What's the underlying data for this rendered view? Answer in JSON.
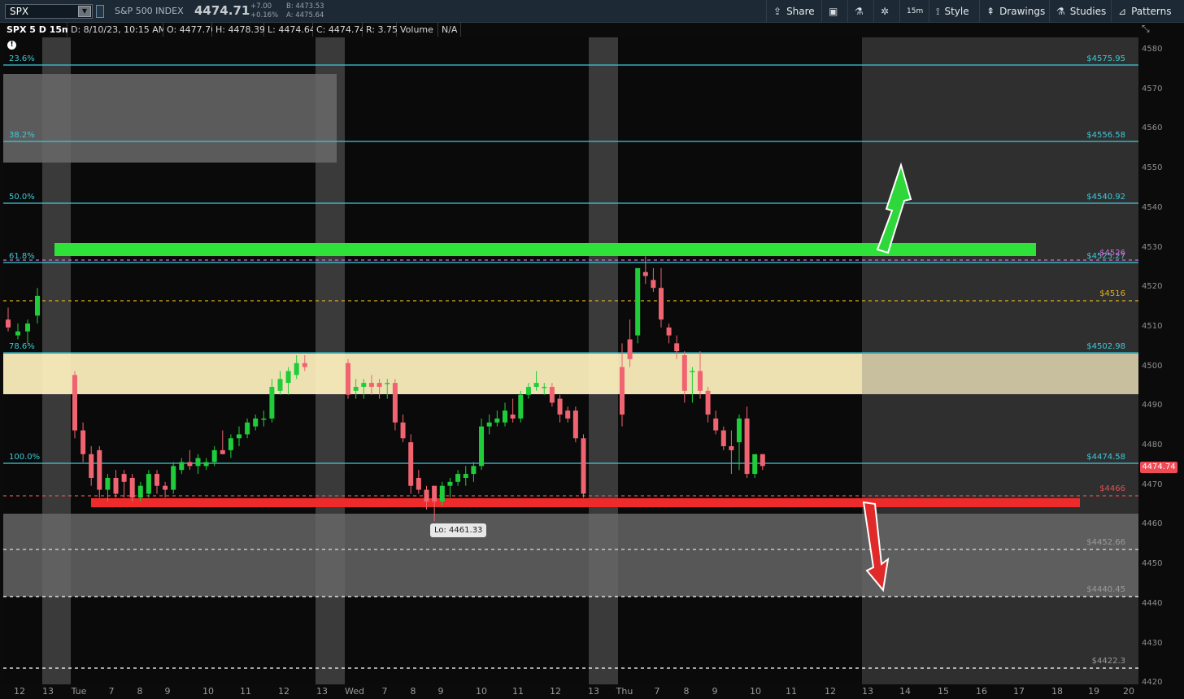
{
  "toolbar": {
    "symbol": "SPX",
    "name": "S&P 500 INDEX",
    "last": "4474.71",
    "change": "+7.00",
    "change_pct": "+0.16%",
    "bid": "B: 4473.53",
    "ask": "A: 4475.64",
    "buttons": {
      "share": "Share",
      "interval": "15m",
      "style": "Style",
      "drawings": "Drawings",
      "studies": "Studies",
      "patterns": "Patterns"
    }
  },
  "info": {
    "title": "SPX 5 D 15m",
    "date": "D: 8/10/23, 10:15 AM",
    "open": "O: 4477.76",
    "high": "H: 4478.39",
    "low": "L: 4474.64",
    "close": "C: 4474.74",
    "range": "R: 3.75",
    "volume": "Volume",
    "volume_value": "N/A"
  },
  "axis": {
    "price_ticks": [
      "4580",
      "4570",
      "4560",
      "4550",
      "4540",
      "4530",
      "4520",
      "4510",
      "4500",
      "4490",
      "4480",
      "4470",
      "4460",
      "4450",
      "4440",
      "4430",
      "4420"
    ],
    "time_ticks": [
      "12",
      "13",
      "Tue",
      "7",
      "8",
      "9",
      "10",
      "11",
      "12",
      "13",
      "Wed",
      "7",
      "8",
      "9",
      "10",
      "11",
      "12",
      "13",
      "Thu",
      "7",
      "8",
      "9",
      "10",
      "11",
      "12",
      "13",
      "14",
      "15",
      "16",
      "17",
      "18",
      "19",
      "20"
    ],
    "current_price_tag": "4474.74"
  },
  "levels": {
    "fib": [
      {
        "pct": "23.6%",
        "price_label": "$4575.95"
      },
      {
        "pct": "38.2%",
        "price_label": "$4556.58"
      },
      {
        "pct": "50.0%",
        "price_label": "$4540.92"
      },
      {
        "pct": "61.8%",
        "price_label": "$4525.27"
      },
      {
        "pct": "78.6%",
        "price_label": "$4502.98"
      },
      {
        "pct": "100.0%",
        "price_label": "$4474.58"
      }
    ],
    "h_lines": [
      {
        "label": "$4526"
      },
      {
        "label": "$4516"
      },
      {
        "label": "$4466"
      },
      {
        "label": "$4452.66"
      },
      {
        "label": "$4440.45"
      },
      {
        "label": "$4422.3"
      }
    ],
    "low_callout": "Lo: 4461.33"
  },
  "colors": {
    "bull": "#1fcd3a",
    "bear": "#ef6470",
    "fib": "#3ec9d8",
    "green_band": "#2fe23a",
    "red_band": "#ee2a2a",
    "zone": "#fff2c0"
  },
  "chart_data": {
    "type": "candlestick",
    "title": "SPX 5 D 15m",
    "ylim": [
      4418,
      4584
    ],
    "candles": [
      {
        "o": 4512,
        "h": 4515,
        "l": 4509,
        "c": 4510
      },
      {
        "o": 4508,
        "h": 4511,
        "l": 4507,
        "c": 4509
      },
      {
        "o": 4509,
        "h": 4512,
        "l": 4506,
        "c": 4511
      },
      {
        "o": 4513,
        "h": 4520,
        "l": 4511,
        "c": 4518
      },
      {
        "o": 4498,
        "h": 4499,
        "l": 4482,
        "c": 4484
      },
      {
        "o": 4484,
        "h": 4486,
        "l": 4476,
        "c": 4478
      },
      {
        "o": 4478,
        "h": 4480,
        "l": 4470,
        "c": 4472
      },
      {
        "o": 4479,
        "h": 4480,
        "l": 4467,
        "c": 4469
      },
      {
        "o": 4469,
        "h": 4473,
        "l": 4466,
        "c": 4472
      },
      {
        "o": 4472,
        "h": 4474,
        "l": 4467,
        "c": 4468
      },
      {
        "o": 4473,
        "h": 4474,
        "l": 4467,
        "c": 4471
      },
      {
        "o": 4472,
        "h": 4473,
        "l": 4466,
        "c": 4467
      },
      {
        "o": 4467,
        "h": 4471,
        "l": 4466,
        "c": 4470
      },
      {
        "o": 4468,
        "h": 4474,
        "l": 4467,
        "c": 4473
      },
      {
        "o": 4473,
        "h": 4474,
        "l": 4468,
        "c": 4470
      },
      {
        "o": 4470,
        "h": 4471,
        "l": 4467,
        "c": 4469
      },
      {
        "o": 4469,
        "h": 4476,
        "l": 4468,
        "c": 4475
      },
      {
        "o": 4474,
        "h": 4477,
        "l": 4473,
        "c": 4476
      },
      {
        "o": 4476,
        "h": 4479,
        "l": 4474,
        "c": 4475
      },
      {
        "o": 4475,
        "h": 4478,
        "l": 4473,
        "c": 4477
      },
      {
        "o": 4475,
        "h": 4477,
        "l": 4474,
        "c": 4476
      },
      {
        "o": 4476,
        "h": 4480,
        "l": 4475,
        "c": 4479
      },
      {
        "o": 4479,
        "h": 4484,
        "l": 4478,
        "c": 4478
      },
      {
        "o": 4479,
        "h": 4483,
        "l": 4477,
        "c": 4482
      },
      {
        "o": 4482,
        "h": 4485,
        "l": 4480,
        "c": 4483
      },
      {
        "o": 4483,
        "h": 4487,
        "l": 4482,
        "c": 4486
      },
      {
        "o": 4485,
        "h": 4488,
        "l": 4484,
        "c": 4487
      },
      {
        "o": 4487,
        "h": 4489,
        "l": 4485,
        "c": 4487
      },
      {
        "o": 4487,
        "h": 4497,
        "l": 4486,
        "c": 4495
      },
      {
        "o": 4494,
        "h": 4499,
        "l": 4493,
        "c": 4497
      },
      {
        "o": 4496,
        "h": 4500,
        "l": 4493,
        "c": 4499
      },
      {
        "o": 4498,
        "h": 4503,
        "l": 4497,
        "c": 4501
      },
      {
        "o": 4501,
        "h": 4503,
        "l": 4499,
        "c": 4500
      },
      {
        "o": 4501,
        "h": 4502,
        "l": 4492,
        "c": 4493
      },
      {
        "o": 4494,
        "h": 4497,
        "l": 4492,
        "c": 4495
      },
      {
        "o": 4495,
        "h": 4497,
        "l": 4492,
        "c": 4496
      },
      {
        "o": 4496,
        "h": 4498,
        "l": 4493,
        "c": 4495
      },
      {
        "o": 4496,
        "h": 4497,
        "l": 4492,
        "c": 4495
      },
      {
        "o": 4496,
        "h": 4497,
        "l": 4492,
        "c": 4496
      },
      {
        "o": 4496,
        "h": 4497,
        "l": 4484,
        "c": 4486
      },
      {
        "o": 4486,
        "h": 4488,
        "l": 4481,
        "c": 4482
      },
      {
        "o": 4481,
        "h": 4483,
        "l": 4468,
        "c": 4470
      },
      {
        "o": 4472,
        "h": 4474,
        "l": 4468,
        "c": 4469
      },
      {
        "o": 4469,
        "h": 4470,
        "l": 4464,
        "c": 4466
      },
      {
        "o": 4470,
        "h": 4470,
        "l": 4461,
        "c": 4466
      },
      {
        "o": 4466,
        "h": 4471,
        "l": 4465,
        "c": 4470
      },
      {
        "o": 4470,
        "h": 4472,
        "l": 4467,
        "c": 4471
      },
      {
        "o": 4471,
        "h": 4474,
        "l": 4470,
        "c": 4473
      },
      {
        "o": 4472,
        "h": 4475,
        "l": 4470,
        "c": 4473
      },
      {
        "o": 4473,
        "h": 4476,
        "l": 4471,
        "c": 4475
      },
      {
        "o": 4475,
        "h": 4487,
        "l": 4474,
        "c": 4485
      },
      {
        "o": 4485,
        "h": 4488,
        "l": 4483,
        "c": 4486
      },
      {
        "o": 4486,
        "h": 4489,
        "l": 4485,
        "c": 4487
      },
      {
        "o": 4486,
        "h": 4491,
        "l": 4485,
        "c": 4489
      },
      {
        "o": 4488,
        "h": 4492,
        "l": 4486,
        "c": 4487
      },
      {
        "o": 4487,
        "h": 4494,
        "l": 4486,
        "c": 4493
      },
      {
        "o": 4493,
        "h": 4496,
        "l": 4492,
        "c": 4495
      },
      {
        "o": 4495,
        "h": 4499,
        "l": 4494,
        "c": 4496
      },
      {
        "o": 4495,
        "h": 4496,
        "l": 4493,
        "c": 4495
      },
      {
        "o": 4495,
        "h": 4496,
        "l": 4490,
        "c": 4491
      },
      {
        "o": 4492,
        "h": 4493,
        "l": 4486,
        "c": 4488
      },
      {
        "o": 4489,
        "h": 4490,
        "l": 4486,
        "c": 4487
      },
      {
        "o": 4489,
        "h": 4490,
        "l": 4481,
        "c": 4482
      },
      {
        "o": 4482,
        "h": 4483,
        "l": 4467,
        "c": 4468
      },
      {
        "o": 4500,
        "h": 4506,
        "l": 4485,
        "c": 4488
      },
      {
        "o": 4507,
        "h": 4512,
        "l": 4500,
        "c": 4502
      },
      {
        "o": 4508,
        "h": 4525,
        "l": 4506,
        "c": 4525
      },
      {
        "o": 4524,
        "h": 4528,
        "l": 4521,
        "c": 4523
      },
      {
        "o": 4522,
        "h": 4525,
        "l": 4519,
        "c": 4520
      },
      {
        "o": 4520,
        "h": 4525,
        "l": 4510,
        "c": 4512
      },
      {
        "o": 4510,
        "h": 4511,
        "l": 4506,
        "c": 4508
      },
      {
        "o": 4506,
        "h": 4508,
        "l": 4502,
        "c": 4504
      },
      {
        "o": 4503,
        "h": 4504,
        "l": 4491,
        "c": 4494
      },
      {
        "o": 4499,
        "h": 4500,
        "l": 4491,
        "c": 4499
      },
      {
        "o": 4499,
        "h": 4504,
        "l": 4492,
        "c": 4494
      },
      {
        "o": 4494,
        "h": 4495,
        "l": 4486,
        "c": 4488
      },
      {
        "o": 4487,
        "h": 4489,
        "l": 4483,
        "c": 4484
      },
      {
        "o": 4484,
        "h": 4485,
        "l": 4479,
        "c": 4480
      },
      {
        "o": 4480,
        "h": 4484,
        "l": 4473,
        "c": 4479
      },
      {
        "o": 4481,
        "h": 4488,
        "l": 4474,
        "c": 4487
      },
      {
        "o": 4487,
        "h": 4490,
        "l": 4472,
        "c": 4473
      },
      {
        "o": 4473,
        "h": 4477,
        "l": 4472,
        "c": 4478
      },
      {
        "o": 4478,
        "h": 4478,
        "l": 4474,
        "c": 4475
      }
    ]
  }
}
